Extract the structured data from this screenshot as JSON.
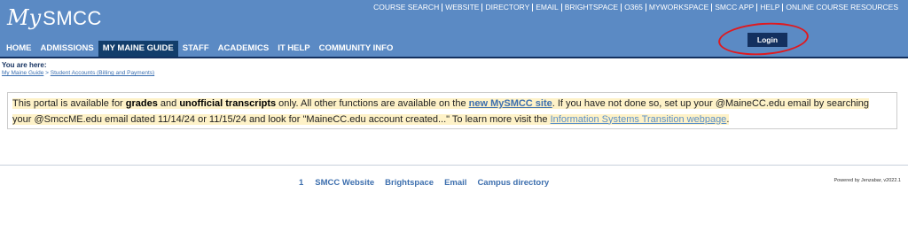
{
  "header": {
    "logo_my": "My",
    "logo_name": "SMCC",
    "util_links": [
      "COURSE SEARCH",
      "WEBSITE",
      "DIRECTORY",
      "EMAIL",
      "BRIGHTSPACE",
      "O365",
      "MYWORKSPACE",
      "SMCC APP",
      "HELP",
      "ONLINE COURSE RESOURCES"
    ],
    "nav": [
      "HOME",
      "ADMISSIONS",
      "MY MAINE GUIDE",
      "STAFF",
      "ACADEMICS",
      "IT HELP",
      "COMMUNITY INFO"
    ],
    "active_nav": "MY MAINE GUIDE",
    "login_label": "Login"
  },
  "breadcrumb": {
    "you_are_here": "You are here:",
    "items": [
      "My Maine Guide",
      "Student Accounts (Billing and Payments)"
    ],
    "separator": ">"
  },
  "notice": {
    "t1": "This portal is available for ",
    "b1": "grades",
    "t2": " and ",
    "b2": "unofficial transcripts",
    "t3": " only.  All other functions are available on the ",
    "link1": "new MySMCC site",
    "t4": ". If you have not done so, set up your @MaineCC.edu email by searching your @SmccME.edu email dated 11/14/24 or 11/15/24 and look for \"MaineCC.edu account created...\"   To learn more visit the ",
    "link2": "Information Systems Transition webpage",
    "t5": "."
  },
  "footer": {
    "page_number": "1",
    "links": [
      "SMCC Website",
      "Brightspace",
      "Email",
      "Campus directory"
    ],
    "powered": "Powered by Jenzabar, v2022.1"
  },
  "colors": {
    "header_bg": "#5b8ac4",
    "nav_active_bg": "#123d6b",
    "login_bg": "#13305f",
    "annotation_circle": "#e0191e",
    "notice_highlight": "#fef2c8",
    "link": "#3d6fae"
  }
}
